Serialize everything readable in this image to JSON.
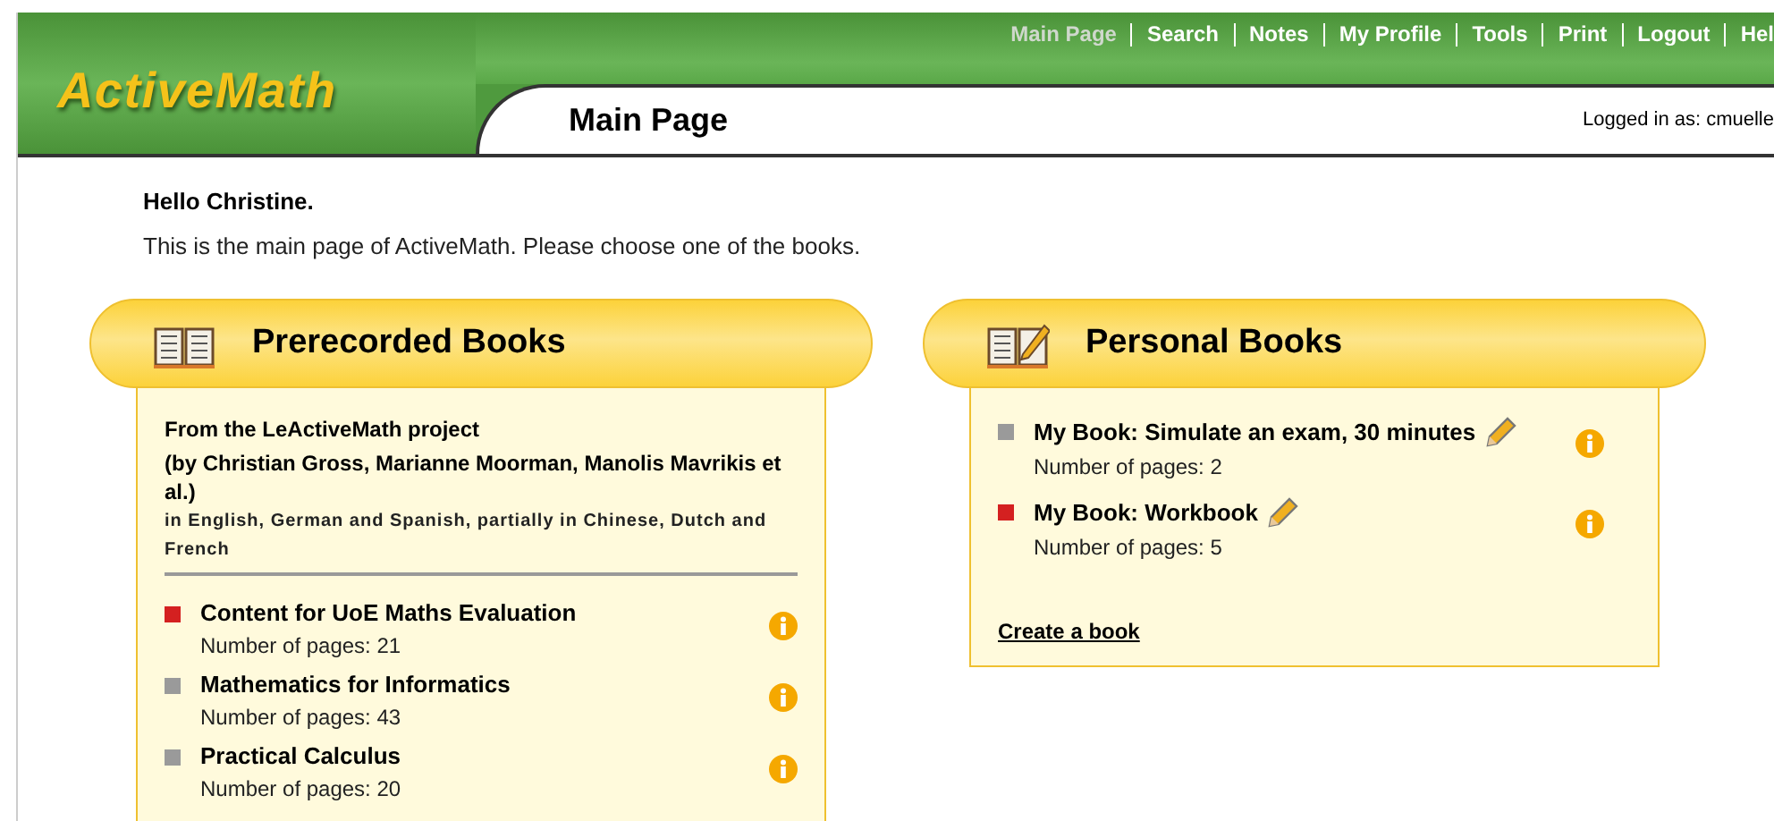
{
  "logo": "ActiveMath",
  "nav": [
    {
      "label": "Main Page",
      "selected": true
    },
    {
      "label": "Search",
      "selected": false
    },
    {
      "label": "Notes",
      "selected": false
    },
    {
      "label": "My Profile",
      "selected": false
    },
    {
      "label": "Tools",
      "selected": false
    },
    {
      "label": "Print",
      "selected": false
    },
    {
      "label": "Logout",
      "selected": false
    },
    {
      "label": "Hel",
      "selected": false
    }
  ],
  "page_title": "Main Page",
  "logged_in": "Logged in as: cmuelle",
  "greeting": "Hello Christine.",
  "intro": "This is the main page of ActiveMath. Please choose one of the books.",
  "prerecorded": {
    "title": "Prerecorded Books",
    "source": "From the LeActiveMath project",
    "authors": "(by Christian Gross, Marianne Moorman, Manolis Mavrikis et al.)",
    "languages": "in English, German and Spanish, partially in Chinese, Dutch and French",
    "books": [
      {
        "title": "Content for UoE Maths Evaluation",
        "pages": "Number of pages: 21",
        "color": "#d42020"
      },
      {
        "title": "Mathematics for Informatics",
        "pages": "Number of pages: 43",
        "color": "#9a9a9a"
      },
      {
        "title": "Practical Calculus",
        "pages": "Number of pages: 20",
        "color": "#9a9a9a"
      }
    ]
  },
  "personal": {
    "title": "Personal Books",
    "books": [
      {
        "title": "My Book: Simulate an exam, 30 minutes",
        "pages": "Number of pages: 2",
        "color": "#9a9a9a"
      },
      {
        "title": "My Book: Workbook",
        "pages": "Number of pages: 5",
        "color": "#d42020"
      }
    ],
    "create": "Create a book"
  }
}
